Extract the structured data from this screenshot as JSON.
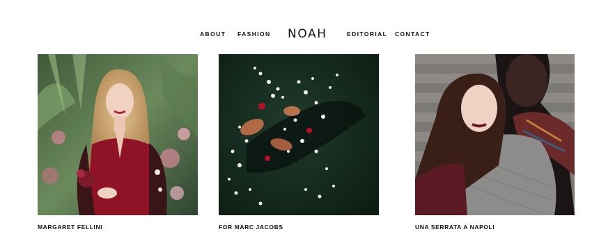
{
  "nav": {
    "links_left": [
      "About",
      "Fashion"
    ],
    "brand": "NOAH",
    "links_right": [
      "Editorial",
      "Contact"
    ]
  },
  "gallery": [
    {
      "caption": "MARGARET FELLINI",
      "image": "woman with blonde hair in red dress among flowers"
    },
    {
      "caption": "FOR MARC JACOBS",
      "image": "figure floating in dark water with white flowers"
    },
    {
      "caption": "UNA SERRATA A NAPOLI",
      "image": "two women embracing in knit sweaters"
    }
  ],
  "colors": {
    "text": "#111111",
    "background": "#ffffff"
  }
}
